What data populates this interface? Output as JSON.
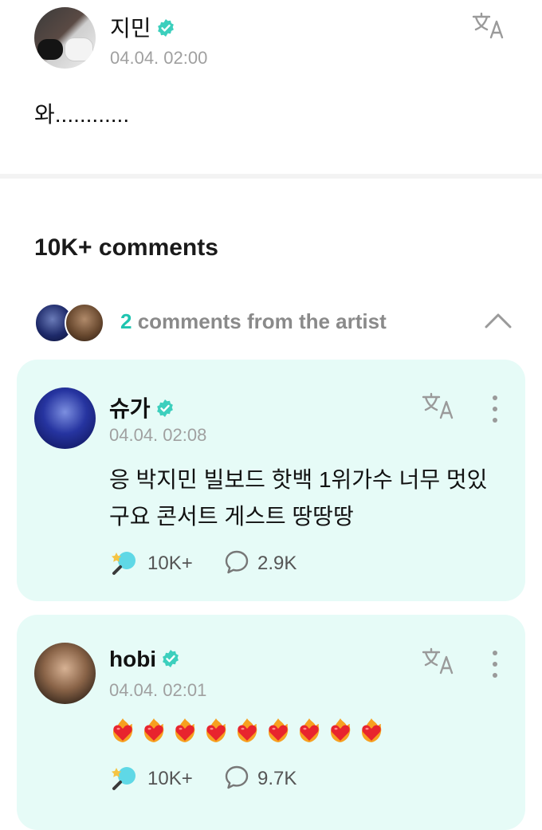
{
  "post": {
    "author": "지민",
    "time": "04.04. 02:00",
    "body": "와............"
  },
  "comments_section": {
    "title": "10K+ comments",
    "artist_count": "2",
    "artist_label": " comments from the artist"
  },
  "comments": [
    {
      "author": "슈가",
      "time": "04.04. 02:08",
      "body": "응 박지민 빌보드 핫백 1위가수 너무 멋있구요 콘서트 게스트 땅땅땅",
      "likes": "10K+",
      "replies": "2.9K"
    },
    {
      "author": "hobi",
      "time": "04.04. 02:01",
      "hearts": 9,
      "likes": "10K+",
      "replies": "9.7K"
    }
  ],
  "colors": {
    "accent": "#1fc4b0",
    "card_bg": "#e6fbf7",
    "muted": "#a0a0a0"
  },
  "icons": {
    "verified": "verified-check-icon",
    "translate": "translate-icon",
    "more": "more-vertical-icon",
    "collapse": "chevron-up-icon",
    "like": "lightstick-like-icon",
    "reply": "speech-bubble-icon",
    "heart": "heart-on-fire-emoji"
  }
}
